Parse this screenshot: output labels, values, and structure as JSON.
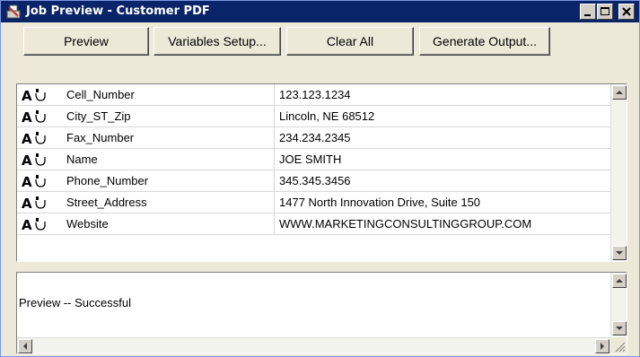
{
  "window": {
    "title": "Job Preview - Customer PDF",
    "titlebar_color": "#0a246a",
    "caption_buttons": [
      "minimize-icon",
      "maximize-icon",
      "close-icon"
    ]
  },
  "toolbar": {
    "preview_label": "Preview",
    "variables_setup_label": "Variables Setup...",
    "clear_all_label": "Clear All",
    "generate_output_label": "Generate Output..."
  },
  "variables": [
    {
      "type_icon": "text-variable-icon",
      "name": "Cell_Number",
      "value": "123.123.1234"
    },
    {
      "type_icon": "text-variable-icon",
      "name": "City_ST_Zip",
      "value": "Lincoln, NE 68512"
    },
    {
      "type_icon": "text-variable-icon",
      "name": "Fax_Number",
      "value": "234.234.2345"
    },
    {
      "type_icon": "text-variable-icon",
      "name": "Name",
      "value": "JOE SMITH"
    },
    {
      "type_icon": "text-variable-icon",
      "name": "Phone_Number",
      "value": "345.345.3456"
    },
    {
      "type_icon": "text-variable-icon",
      "name": "Street_Address",
      "value": "1477 North Innovation Drive, Suite 150"
    },
    {
      "type_icon": "text-variable-icon",
      "name": "Website",
      "value": "WWW.MARKETINGCONSULTINGGROUP.COM"
    }
  ],
  "status": {
    "message": "Preview -- Successful"
  }
}
